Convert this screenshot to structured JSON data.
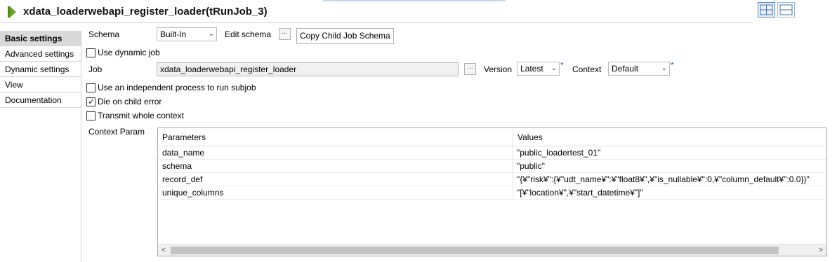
{
  "window": {
    "title": "xdata_loaderwebapi_register_loader(tRunJob_3)"
  },
  "icons": {
    "title": "run-job-icon",
    "layout_grid": "grid-layout-icon",
    "layout_rows": "rows-layout-icon",
    "ellipsis": "ellipsis-icon",
    "dropdown": "chevron-down-icon",
    "check": "checkmark-icon"
  },
  "colors": {
    "title_icon": "#6aa12a",
    "required_marker": "#1f5fbf",
    "active_nav": "#d9d9d9"
  },
  "sidebar": {
    "items": [
      {
        "label": "Basic settings",
        "active": true
      },
      {
        "label": "Advanced settings",
        "active": false
      },
      {
        "label": "Dynamic settings",
        "active": false
      },
      {
        "label": "View",
        "active": false
      },
      {
        "label": "Documentation",
        "active": false
      }
    ]
  },
  "form": {
    "schema_label": "Schema",
    "schema_value": "Built-In",
    "edit_schema_label": "Edit schema",
    "edit_schema_button": "...",
    "copy_child_button": "Copy Child Job Schema",
    "use_dynamic_job": {
      "label": "Use dynamic job",
      "checked": false
    },
    "job_label": "Job",
    "job_value": "xdata_loaderwebapi_register_loader",
    "job_browse": "...",
    "version_label": "Version",
    "version_value": "Latest",
    "context_label": "Context",
    "context_value": "Default",
    "required_marker": "*",
    "independent_process": {
      "label": "Use an independent process to run subjob",
      "checked": false
    },
    "die_on_child_error": {
      "label": "Die on child error",
      "checked": true
    },
    "transmit_context": {
      "label": "Transmit whole context",
      "checked": false
    },
    "context_param_label": "Context Param"
  },
  "context_table": {
    "columns": [
      "Parameters",
      "Values"
    ],
    "rows": [
      {
        "parameter": "data_name",
        "value": "\"public_loadertest_01\""
      },
      {
        "parameter": "schema",
        "value": "\"public\""
      },
      {
        "parameter": "record_def",
        "value": "\"{¥\"risk¥\":{¥\"udt_name¥\":¥\"float8¥\",¥\"is_nullable¥\":0,¥\"column_default¥\":0.0}}\""
      },
      {
        "parameter": "unique_columns",
        "value": "\"[¥\"location¥\",¥\"start_datetime¥\"]\""
      }
    ],
    "scroll_left": "<",
    "scroll_right": ">"
  }
}
